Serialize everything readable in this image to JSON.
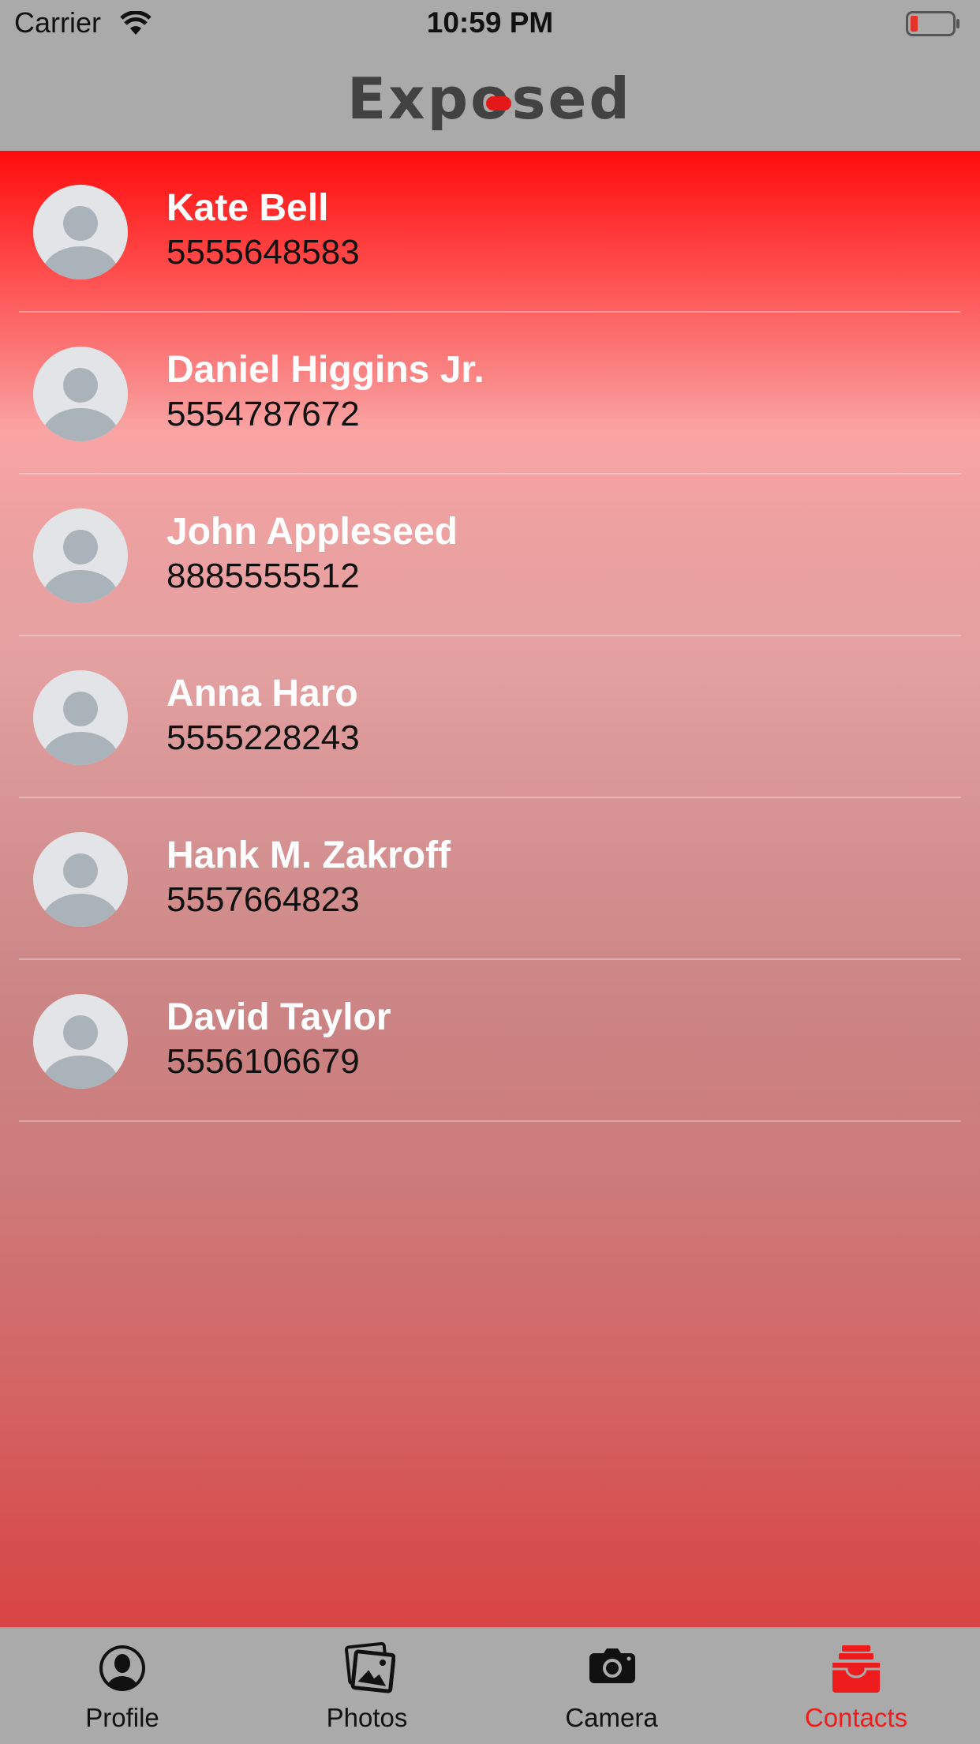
{
  "status_bar": {
    "carrier": "Carrier",
    "time": "10:59 PM",
    "battery_color": "#e5322a"
  },
  "nav": {
    "logo_text": "Exposed",
    "accent": "#e41818"
  },
  "contacts": [
    {
      "name": "Kate Bell",
      "phone": "5555648583"
    },
    {
      "name": "Daniel Higgins Jr.",
      "phone": "5554787672"
    },
    {
      "name": "John Appleseed",
      "phone": "8885555512"
    },
    {
      "name": "Anna Haro",
      "phone": "5555228243"
    },
    {
      "name": "Hank M. Zakroff",
      "phone": "5557664823"
    },
    {
      "name": "David Taylor",
      "phone": "5556106679"
    }
  ],
  "tabs": [
    {
      "label": "Profile",
      "icon": "profile-icon",
      "active": false
    },
    {
      "label": "Photos",
      "icon": "photos-icon",
      "active": false
    },
    {
      "label": "Camera",
      "icon": "camera-icon",
      "active": false
    },
    {
      "label": "Contacts",
      "icon": "contacts-icon",
      "active": true
    }
  ],
  "colors": {
    "active_tab": "#ee1c1c",
    "list_gradient_top": "#ff0b0b",
    "list_gradient_bottom": "#d84444"
  }
}
